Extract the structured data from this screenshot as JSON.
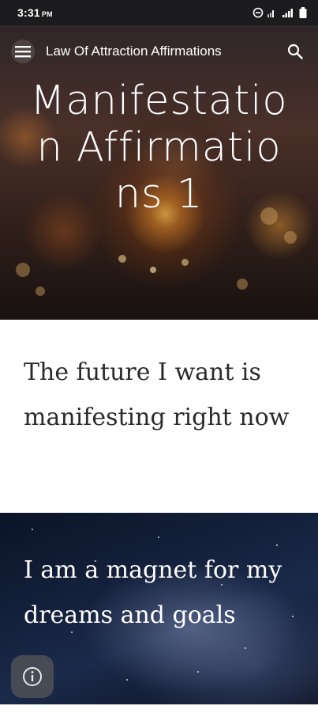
{
  "status_bar": {
    "time": "3:31",
    "ampm": "PM"
  },
  "app_bar": {
    "title": "Law Of Attraction Affirmations",
    "menu_icon": "hamburger-menu-icon",
    "search_icon": "search-icon"
  },
  "hero": {
    "title": "Manifestation Affirmations 1"
  },
  "sections": [
    {
      "text": "The future I want is manifesting right now"
    },
    {
      "text": "I am a magnet for my dreams and goals"
    }
  ],
  "colors": {
    "status_bar": "#1c1c1e",
    "white_text": "#2a2a2a",
    "overlay_text": "#ffffff"
  }
}
